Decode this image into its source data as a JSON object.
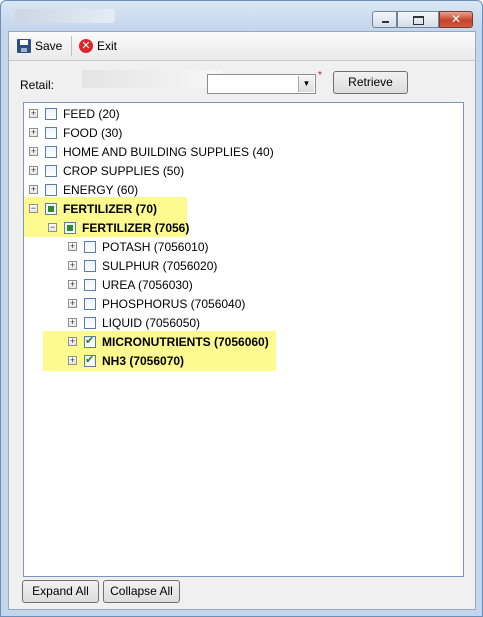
{
  "window": {
    "title": "",
    "minimize": "—",
    "maximize": "□",
    "close": "✕"
  },
  "toolbar": {
    "save_label": "Save",
    "exit_label": "Exit"
  },
  "retail": {
    "label": "Retail:",
    "value": "",
    "required_marker": "*",
    "retrieve_label": "Retrieve"
  },
  "tree": {
    "nodes": [
      {
        "label": "FEED (20)",
        "expander": "+",
        "check": "unchecked"
      },
      {
        "label": "FOOD (30)",
        "expander": "+",
        "check": "unchecked"
      },
      {
        "label": "HOME AND BUILDING SUPPLIES (40)",
        "expander": "+",
        "check": "unchecked"
      },
      {
        "label": "CROP SUPPLIES (50)",
        "expander": "+",
        "check": "unchecked"
      },
      {
        "label": "ENERGY (60)",
        "expander": "+",
        "check": "unchecked"
      },
      {
        "label": "FERTILIZER (70)",
        "expander": "−",
        "check": "partial",
        "highlighted": true
      },
      {
        "label": "FERTILIZER (7056)",
        "expander": "−",
        "check": "partial",
        "highlighted": true
      },
      {
        "label": "POTASH (7056010)",
        "expander": "+",
        "check": "unchecked"
      },
      {
        "label": "SULPHUR (7056020)",
        "expander": "+",
        "check": "unchecked"
      },
      {
        "label": "UREA (7056030)",
        "expander": "+",
        "check": "unchecked"
      },
      {
        "label": "PHOSPHORUS (7056040)",
        "expander": "+",
        "check": "unchecked"
      },
      {
        "label": "LIQUID (7056050)",
        "expander": "+",
        "check": "unchecked"
      },
      {
        "label": "MICRONUTRIENTS (7056060)",
        "expander": "+",
        "check": "checked",
        "highlighted": true
      },
      {
        "label": "NH3 (7056070)",
        "expander": "+",
        "check": "checked",
        "highlighted": true
      }
    ]
  },
  "footer": {
    "expand_all_label": "Expand All",
    "collapse_all_label": "Collapse All"
  },
  "colors": {
    "highlight": "#fdfb8f",
    "checkmark": "#2a7d2a"
  }
}
